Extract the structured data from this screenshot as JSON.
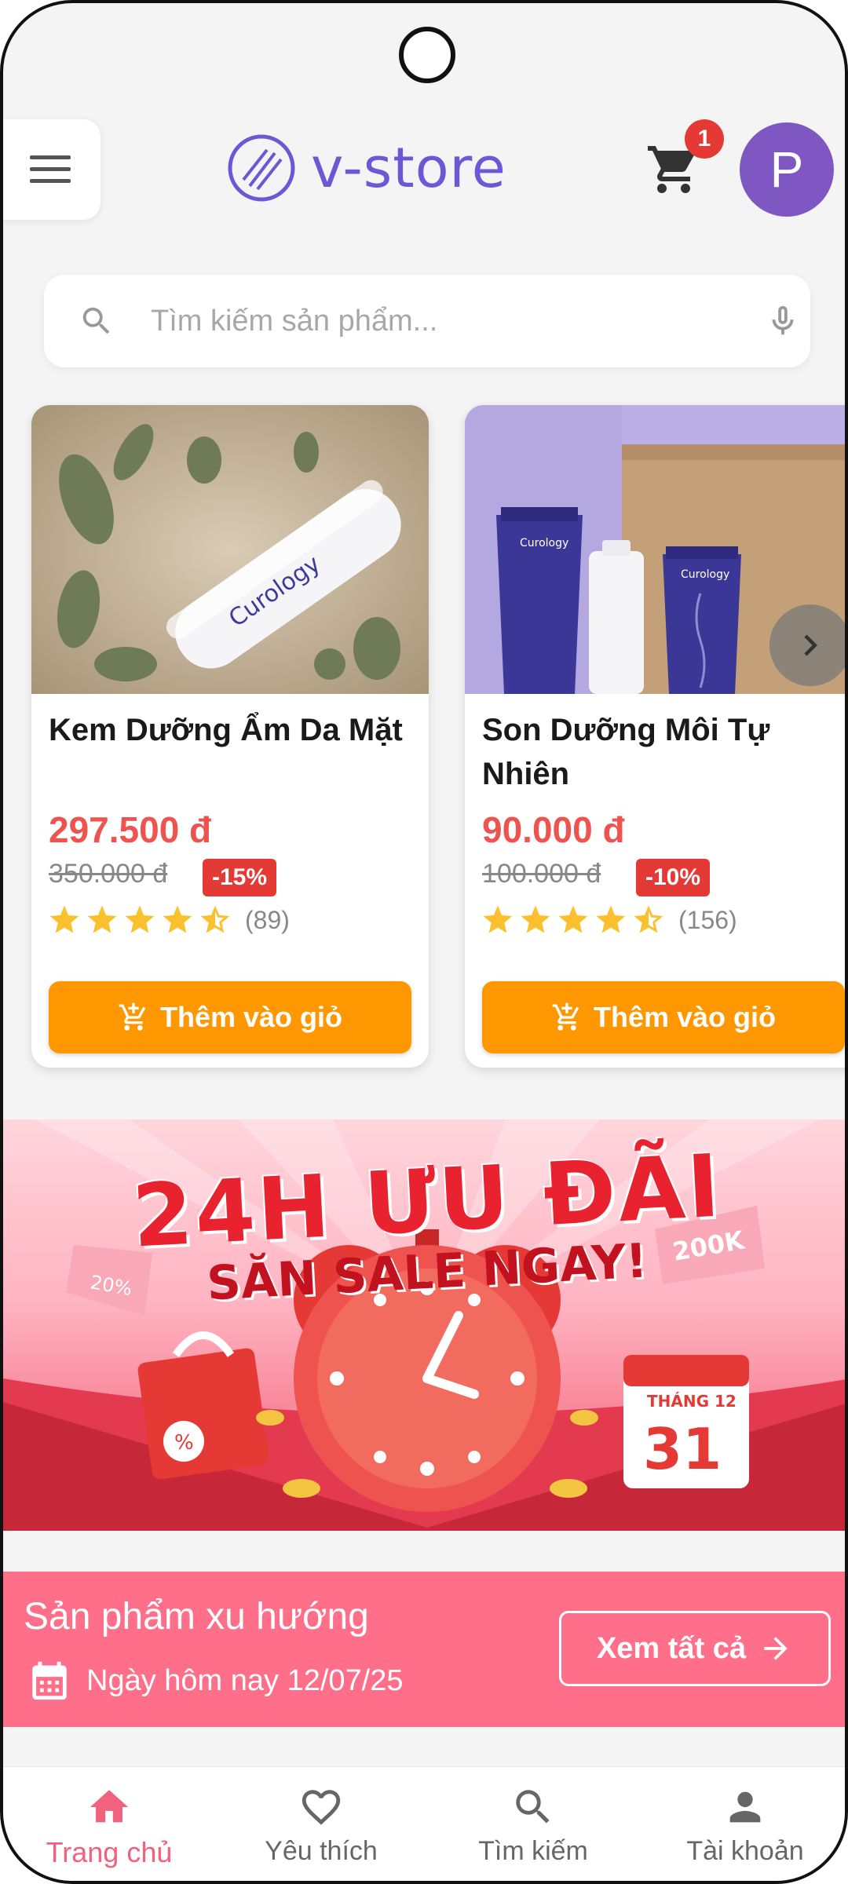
{
  "header": {
    "brand": "v-store",
    "cart_count": "1",
    "avatar_initial": "P"
  },
  "search": {
    "placeholder": "Tìm kiếm sản phẩm..."
  },
  "products": [
    {
      "name": "Kem Dưỡng Ẩm Da Mặt",
      "price": "297.500 đ",
      "old_price": "350.000 đ",
      "discount": "-15%",
      "rating": 4.5,
      "reviews": "(89)",
      "button": "Thêm vào giỏ",
      "image_label": "Curology"
    },
    {
      "name": "Son Dưỡng Môi Tự Nhiên",
      "price": "90.000 đ",
      "old_price": "100.000 đ",
      "discount": "-10%",
      "rating": 4.5,
      "reviews": "(156)",
      "button": "Thêm vào giỏ",
      "image_label": "Curology"
    }
  ],
  "banner": {
    "title": "24H ƯU ĐÃI",
    "subtitle": "SĂN SALE NGAY!",
    "tag_left": "20%",
    "tag_right": "200K",
    "calendar_month": "THÁNG 12",
    "calendar_day": "31"
  },
  "trending": {
    "title": "Sản phẩm xu hướng",
    "date": "Ngày hôm nay 12/07/25",
    "see_all": "Xem tất cả"
  },
  "nav": [
    {
      "label": "Trang chủ",
      "icon": "home-icon",
      "active": true
    },
    {
      "label": "Yêu thích",
      "icon": "heart-icon",
      "active": false
    },
    {
      "label": "Tìm kiếm",
      "icon": "search-icon",
      "active": false
    },
    {
      "label": "Tài khoản",
      "icon": "person-icon",
      "active": false
    }
  ],
  "colors": {
    "brand": "#6b58d6",
    "price": "#ef5350",
    "button": "#ff9800",
    "trending_bg": "#ff6f8a",
    "nav_active": "#f0627e",
    "avatar": "#7e57c2"
  }
}
